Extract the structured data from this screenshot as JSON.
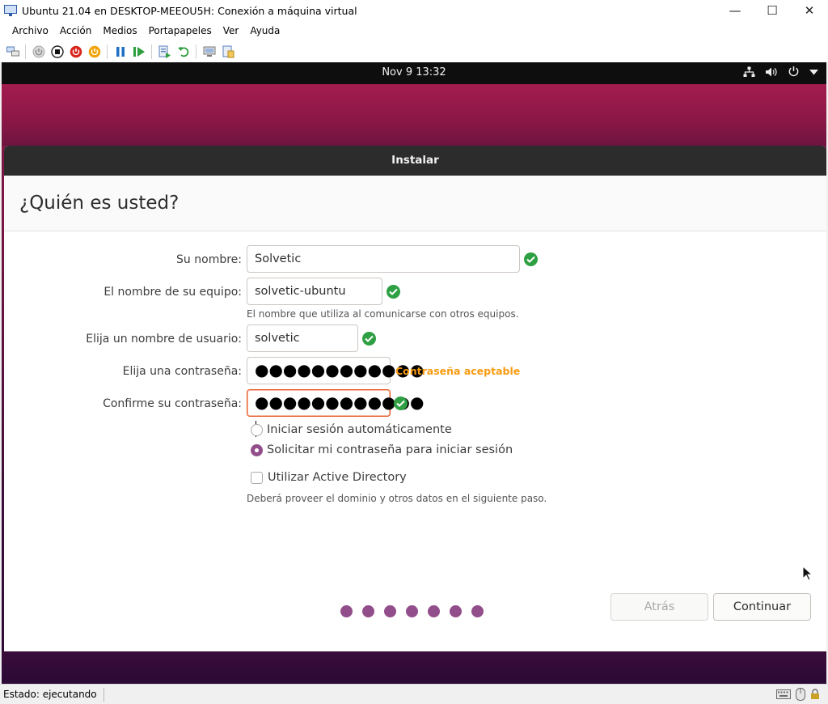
{
  "window": {
    "title": "Ubuntu 21.04 en DESKTOP-MEEOU5H: Conexión a máquina virtual",
    "controls": {
      "minimize": "—",
      "maximize": "☐",
      "close": "✕"
    }
  },
  "menubar": {
    "items": [
      {
        "label": "Archivo"
      },
      {
        "label": "Acción"
      },
      {
        "label": "Medios"
      },
      {
        "label": "Portapapeles"
      },
      {
        "label": "Ver"
      },
      {
        "label": "Ayuda"
      }
    ]
  },
  "toolbar": {
    "icons": [
      "ctrl-alt-del-icon",
      "start-icon",
      "turn-off-icon",
      "shutdown-icon",
      "save-state-icon",
      "pause-icon",
      "resume-icon",
      "checkpoint-icon",
      "revert-icon",
      "enhanced-session-icon",
      "share-icon"
    ]
  },
  "ubuntu": {
    "clock": "Nov 9  13:32",
    "tray_icons": [
      "network-icon",
      "volume-icon",
      "power-icon",
      "menu-arrow-icon"
    ]
  },
  "installer": {
    "header": "Instalar",
    "title": "¿Quién es usted?",
    "fields": {
      "name": {
        "label": "Su nombre:",
        "value": "Solvetic"
      },
      "computer": {
        "label": "El nombre de su equipo:",
        "value": "solvetic-ubuntu",
        "hint": "El nombre que utiliza al comunicarse con otros equipos."
      },
      "username": {
        "label": "Elija un nombre de usuario:",
        "value": "solvetic"
      },
      "password": {
        "label": "Elija una contraseña:",
        "value": "●●●●●●●●●●●●",
        "strength": "Contraseña aceptable"
      },
      "confirm": {
        "label": "Confirme su contraseña:",
        "value": "●●●●●●●●●●●●"
      }
    },
    "login_options": {
      "auto": {
        "label": "Iniciar sesión automáticamente",
        "selected": false
      },
      "password": {
        "label": "Solicitar mi contraseña para iniciar sesión",
        "selected": true
      }
    },
    "active_directory": {
      "label": "Utilizar Active Directory",
      "checked": false,
      "hint": "Deberá proveer el dominio y otros datos en el siguiente paso."
    },
    "buttons": {
      "back": "Atrás",
      "continue": "Continuar"
    },
    "progress_steps": 7
  },
  "statusbar": {
    "status": "Estado: ejecutando"
  },
  "colors": {
    "accent": "#e95420",
    "radio_purple": "#924d8b",
    "check_green": "#2ea043",
    "strength_orange": "#f99b11"
  }
}
